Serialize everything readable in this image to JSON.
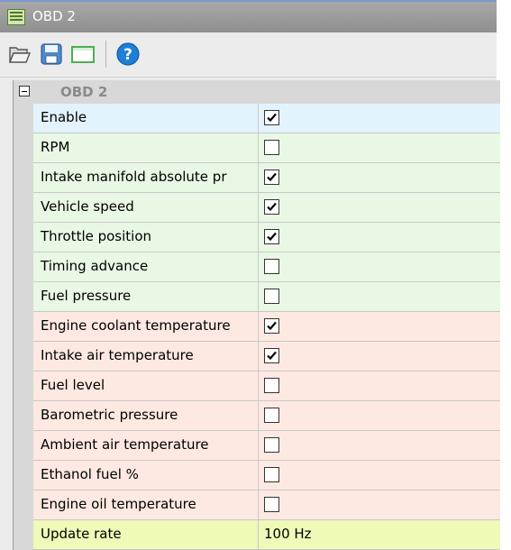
{
  "window": {
    "title": "OBD 2"
  },
  "toolbar": {
    "buttons": [
      {
        "name": "open-button",
        "icon": "folder-open-icon"
      },
      {
        "name": "save-button",
        "icon": "floppy-disk-icon"
      },
      {
        "name": "blank-button",
        "icon": "blank-window-icon"
      },
      {
        "name": "help-button",
        "icon": "help-icon"
      }
    ]
  },
  "category": {
    "label": "OBD 2",
    "expanded": true
  },
  "colors": {
    "blue": "#e3f3fd",
    "green": "#e9f8e4",
    "pink": "#fde9e1",
    "yellow": "#eff9b8"
  },
  "properties": [
    {
      "name": "Enable",
      "type": "checkbox",
      "checked": true,
      "tint": "blue"
    },
    {
      "name": "RPM",
      "type": "checkbox",
      "checked": false,
      "tint": "green"
    },
    {
      "name": "Intake manifold absolute pr",
      "type": "checkbox",
      "checked": true,
      "tint": "green"
    },
    {
      "name": "Vehicle speed",
      "type": "checkbox",
      "checked": true,
      "tint": "green"
    },
    {
      "name": "Throttle position",
      "type": "checkbox",
      "checked": true,
      "tint": "green"
    },
    {
      "name": "Timing advance",
      "type": "checkbox",
      "checked": false,
      "tint": "green"
    },
    {
      "name": "Fuel pressure",
      "type": "checkbox",
      "checked": false,
      "tint": "green"
    },
    {
      "name": "Engine coolant temperature",
      "type": "checkbox",
      "checked": true,
      "tint": "pink"
    },
    {
      "name": "Intake air temperature",
      "type": "checkbox",
      "checked": true,
      "tint": "pink"
    },
    {
      "name": "Fuel level",
      "type": "checkbox",
      "checked": false,
      "tint": "pink"
    },
    {
      "name": "Barometric pressure",
      "type": "checkbox",
      "checked": false,
      "tint": "pink"
    },
    {
      "name": "Ambient air temperature",
      "type": "checkbox",
      "checked": false,
      "tint": "pink"
    },
    {
      "name": "Ethanol fuel %",
      "type": "checkbox",
      "checked": false,
      "tint": "pink"
    },
    {
      "name": "Engine oil temperature",
      "type": "checkbox",
      "checked": false,
      "tint": "pink"
    },
    {
      "name": "Update rate",
      "type": "text",
      "value": "100 Hz",
      "tint": "yellow"
    }
  ]
}
